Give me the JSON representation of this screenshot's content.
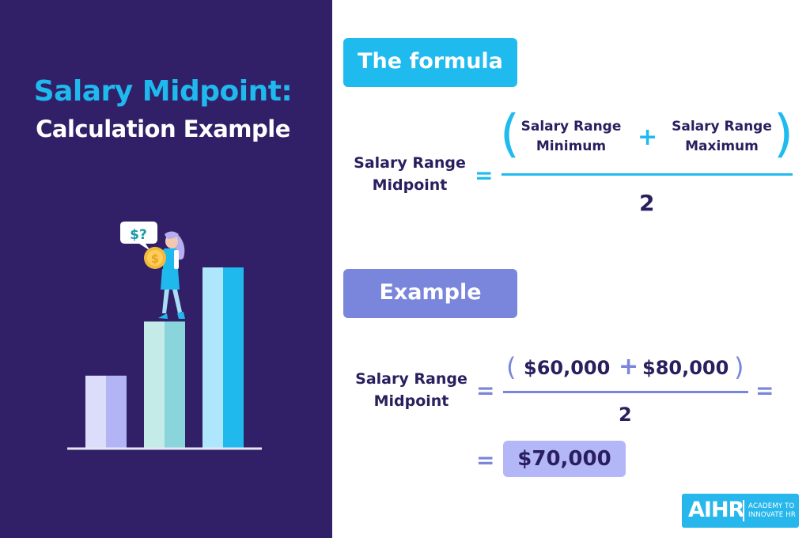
{
  "header": {
    "title_line1": "Salary Midpoint:",
    "title_line2": "Calculation Example"
  },
  "illustration": {
    "speech_bubble": "$?",
    "coin_symbol": "$",
    "bars": [
      {
        "name": "low",
        "relative_height": 0.4,
        "light": "#dcdcfb",
        "dark": "#b3b4f5"
      },
      {
        "name": "mid",
        "relative_height": 0.7,
        "light": "#c4ebe8",
        "dark": "#8ad4db"
      },
      {
        "name": "high",
        "relative_height": 1.0,
        "light": "#aee6fb",
        "dark": "#1fb9ee"
      }
    ]
  },
  "formula": {
    "label": "The formula",
    "lhs": [
      "Salary Range",
      "Midpoint"
    ],
    "equals": "=",
    "open_paren": "(",
    "close_paren": ")",
    "term1": [
      "Salary Range",
      "Minimum"
    ],
    "plus": "+",
    "term2": [
      "Salary Range",
      "Maximum"
    ],
    "denominator": "2"
  },
  "example": {
    "label": "Example",
    "lhs": [
      "Salary Range",
      "Midpoint"
    ],
    "equals": "=",
    "open_paren": "(",
    "value1": "$60,000",
    "plus": "+",
    "value2": "$80,000",
    "close_paren": ")",
    "denominator": "2",
    "result": "$70,000"
  },
  "logo": {
    "main": "AIHR",
    "sub_line1": "ACADEMY TO",
    "sub_line2": "INNOVATE HR"
  },
  "colors": {
    "navy": "#312068",
    "cyan": "#1fbbee",
    "periwinkle": "#7a86db",
    "result_bg": "#b4b7f7",
    "text_dark": "#2a1f5e"
  }
}
